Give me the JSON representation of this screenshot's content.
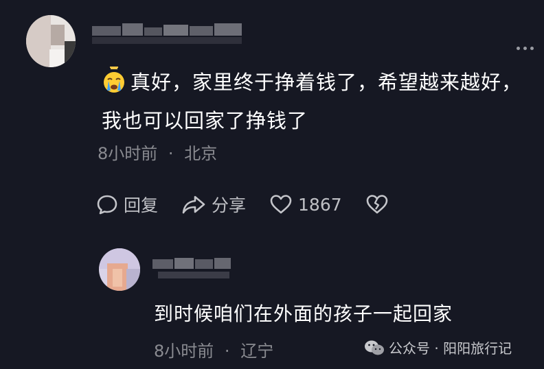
{
  "main_comment": {
    "text": "真好，家里终于挣着钱了，希望越来越好，我也可以回家了挣钱了",
    "emoji": "crying-face",
    "time": "8小时前",
    "separator": "·",
    "location": "北京",
    "actions": {
      "reply_label": "回复",
      "share_label": "分享",
      "like_count": "1867"
    }
  },
  "reply": {
    "text": "到时候咱们在外面的孩子一起回家",
    "time": "8小时前",
    "separator": "·",
    "location": "辽宁"
  },
  "watermark": {
    "text": "公众号 · 阳阳旅行记"
  },
  "colors": {
    "background": "#161823",
    "text": "#ffffff",
    "meta": "#8a8b91"
  }
}
